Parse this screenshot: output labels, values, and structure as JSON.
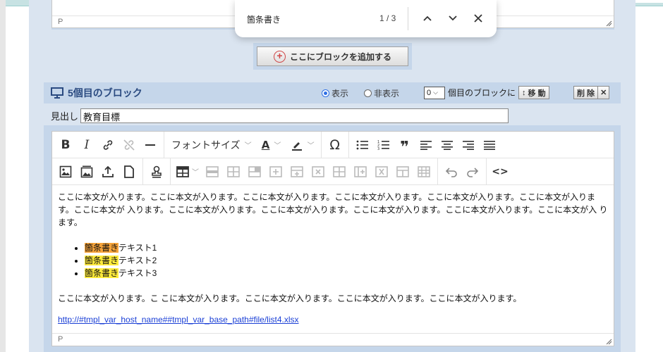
{
  "find_bar": {
    "query": "箇条書き",
    "count": "1 / 3"
  },
  "prev_block": {
    "status_path": "P"
  },
  "add_block": {
    "label": "ここにブロックを追加する"
  },
  "block": {
    "title": "5個目のブロック",
    "show_label": "表示",
    "hide_label": "非表示",
    "order_value": "0",
    "order_suffix": "個目のブロックに",
    "move_label": "移 動",
    "delete_label": "削 除",
    "delete_x": "✕"
  },
  "heading": {
    "label": "見出し",
    "value": "教育目標"
  },
  "toolbar": {
    "font_size_label": "フォントサイズ",
    "text_color_label": "A"
  },
  "content": {
    "paragraph1": "ここに本文が入ります。ここに本文が入ります。ここに本文が入ります。ここに本文が入ります。ここに本文が入ります。ここに本文が入りま す。ここに本文が 入ります。ここに本文が入ります。ここに本文が入ります。ここに本文が入ります。ここに本文が入ります。ここに本文が入 ります。",
    "bullets": [
      {
        "highlight": "箇条書き",
        "rest": "テキスト1"
      },
      {
        "highlight": "箇条書き",
        "rest": "テキスト2"
      },
      {
        "highlight": "箇条書き",
        "rest": "テキスト3"
      }
    ],
    "paragraph2": "ここに本文が入ります。こ こに本文が入ります。ここに本文が入ります。ここに本文が入ります。ここに本文が入ります。",
    "link": "http://#tmpl_var_host_name##tmpl_var_base_path#file/list4.xlsx"
  },
  "editor_status": {
    "path": "P"
  },
  "colors": {
    "accent": "#2a4a80",
    "panel": "#dae4f0",
    "frame": "#c5d6ea",
    "highlight_current": "#f7a43a",
    "highlight_match": "#ffeb3b",
    "link": "#1a3fd6"
  }
}
